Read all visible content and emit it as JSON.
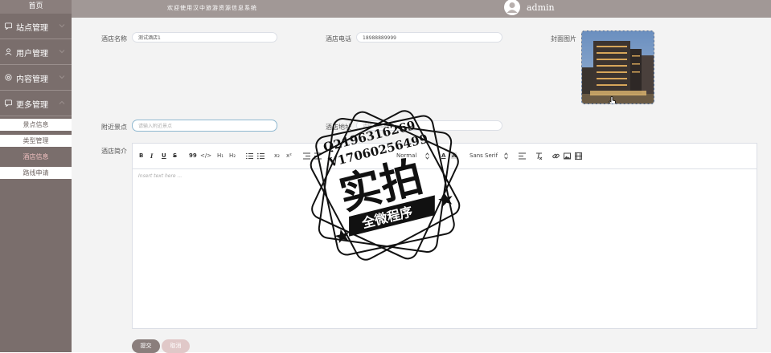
{
  "sidebar": {
    "home": "首页",
    "menus": [
      {
        "label": "站点管理",
        "icon": "chat-icon"
      },
      {
        "label": "用户管理",
        "icon": "user-icon"
      },
      {
        "label": "内容管理",
        "icon": "settings-icon"
      },
      {
        "label": "更多管理",
        "icon": "chat-icon"
      }
    ],
    "submenu": [
      {
        "label": "景点信息",
        "active": false
      },
      {
        "label": "类型管理",
        "active": false
      },
      {
        "label": "酒店信息",
        "active": true
      },
      {
        "label": "路线申请",
        "active": false
      }
    ]
  },
  "header": {
    "welcome": "欢迎使用汉中旅游资源信息系统",
    "user": "admin"
  },
  "form": {
    "hotel_name": {
      "label": "酒店名称",
      "value": "测试酒店1"
    },
    "hotel_phone": {
      "label": "酒店电话",
      "value": "18988889999"
    },
    "cover": {
      "label": "封面图片"
    },
    "nearby": {
      "label": "附近景点",
      "placeholder": "请输入附近景点"
    },
    "address": {
      "label": "酒店地址",
      "placeholder": "请输入酒店地址"
    },
    "intro": {
      "label": "酒店简介"
    }
  },
  "editor": {
    "placeholder": "Insert text here ...",
    "toolbar": {
      "bold": "B",
      "italic": "I",
      "underline": "U",
      "strike": "S",
      "blockquote": "99",
      "code": "</>",
      "h1": "H₁",
      "h2": "H₂",
      "subscript": "x₂",
      "superscript": "x²",
      "size": "Normal",
      "font": "Sans Serif"
    }
  },
  "actions": {
    "submit": "提交",
    "cancel": "取消"
  },
  "watermark": {
    "qq": "Q2196316269",
    "wechat": "V17060256499",
    "title": "实拍",
    "banner": "全微程序"
  },
  "colors": {
    "sidebar": "#7a6e6c",
    "topbar": "#a19896",
    "active_submenu_text": "#f0c0c0",
    "submit_button": "#8a7e7c",
    "cancel_button": "#e0c8c8"
  }
}
